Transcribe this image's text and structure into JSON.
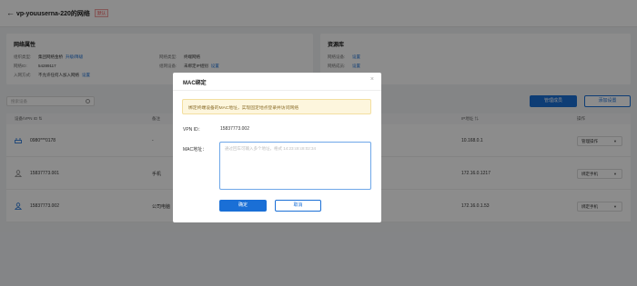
{
  "header": {
    "back_icon": "←",
    "title": "vp-youuserna-220的网络",
    "badge": "默认"
  },
  "network_card": {
    "title": "网络属性",
    "items": [
      {
        "key": "组织类型:",
        "value": "集团网络金桥",
        "link": "升级/降级"
      },
      {
        "key": "网络ID:",
        "value": "54289117",
        "link": ""
      },
      {
        "key": "入网方式:",
        "value": "不允许任何人加入网络",
        "link": "设置"
      },
      {
        "key": "网络类型:",
        "value": "终端网络",
        "link": ""
      },
      {
        "key": "组网设备:",
        "value": "未绑定IP组别",
        "link": "设置"
      }
    ]
  },
  "resource_card": {
    "title": "资源库",
    "items": [
      {
        "key": "网络设备:",
        "value": "",
        "link": "设置"
      },
      {
        "key": "网络成员:",
        "value": "",
        "link": "设置"
      }
    ]
  },
  "toolbar": {
    "search_placeholder": "搜索设备",
    "primary_button": "管理成员",
    "secondary_button": "添加设置"
  },
  "table": {
    "headers": [
      "设备/VPN ID ⇅",
      "备注",
      "IP地址 ⇅",
      "操作"
    ],
    "rows": [
      {
        "id": "0980***0178",
        "note": "-",
        "ip": "10.168.0.1",
        "action": "管理操作"
      },
      {
        "id": "15837773.001",
        "note": "手机",
        "ip": "172.16.0.1217",
        "action": "绑定手机"
      },
      {
        "id": "15837773.002",
        "note": "公司电脑",
        "ip": "172.16.0.1.53",
        "action": "绑定手机"
      }
    ]
  },
  "modal": {
    "title": "MAC绑定",
    "close_icon": "×",
    "notice": "绑定终端设备的MAC地址，实现固定地点登录并访问网络",
    "vpn_label": "VPN ID：",
    "vpn_value": "15837773.002",
    "mac_label": "MAC地址：",
    "mac_placeholder": "通过回车可输入多个地址，格式 14:23:c8:c8:02:34",
    "mac_value": "",
    "ok_label": "确定",
    "cancel_label": "取消"
  },
  "colors": {
    "primary": "#1a6fd6",
    "overlay": "rgba(0,0,0,0.45)",
    "notice_bg": "#fdf6dd"
  }
}
